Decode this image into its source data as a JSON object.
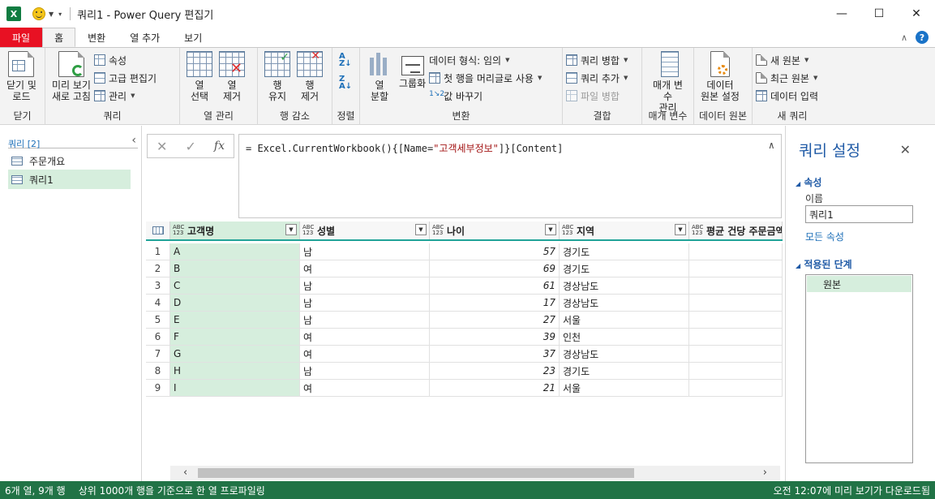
{
  "window": {
    "title": "쿼리1 - Power Query 편집기",
    "minimize": "—",
    "maximize": "☐",
    "close": "✕"
  },
  "tabs": [
    {
      "label": "파일"
    },
    {
      "label": "홈"
    },
    {
      "label": "변환"
    },
    {
      "label": "열 추가"
    },
    {
      "label": "보기"
    }
  ],
  "ribbon": {
    "close": {
      "btn": "닫기 및\n로드",
      "label": "닫기"
    },
    "query": {
      "preview": "미리 보기\n새로 고침",
      "properties": "속성",
      "advanced": "고급 편집기",
      "manage": "관리",
      "label": "쿼리"
    },
    "columns": {
      "select": "열\n선택",
      "remove": "열\n제거",
      "label": "열 관리"
    },
    "rows": {
      "keep": "행\n유지",
      "remove": "행\n제거",
      "label": "행 감소"
    },
    "sort": {
      "label": "정렬"
    },
    "transform": {
      "split": "열\n분할",
      "group": "그룹화",
      "datatype": "데이터 형식: 임의",
      "header": "첫 행을 머리글로 사용",
      "replace": "값 바꾸기",
      "label": "변환"
    },
    "combine": {
      "merge": "쿼리 병합",
      "append": "쿼리 추가",
      "files": "파일 병합",
      "label": "결합"
    },
    "params": {
      "manage": "매개 변수\n관리",
      "label": "매개 변수"
    },
    "datasource": {
      "settings": "데이터\n원본 설정",
      "label": "데이터 원본"
    },
    "newquery": {
      "source": "새 원본",
      "recent": "최근 원본",
      "enter": "데이터 입력",
      "label": "새 쿼리"
    }
  },
  "queries": {
    "header": "쿼리 [2]",
    "items": [
      {
        "label": "주문개요",
        "selected": false
      },
      {
        "label": "쿼리1",
        "selected": true
      }
    ]
  },
  "formula": {
    "prefix": "= Excel.CurrentWorkbook(){[Name=",
    "string": "\"고객세부정보\"",
    "suffix": "]}[Content]"
  },
  "grid": {
    "type_badge": "ABC\n123",
    "columns": [
      "고객명",
      "성별",
      "나이",
      "지역",
      "평균 건당 주문금액"
    ],
    "rows": [
      [
        "1",
        "A",
        "남",
        "57",
        "경기도",
        ""
      ],
      [
        "2",
        "B",
        "여",
        "69",
        "경기도",
        ""
      ],
      [
        "3",
        "C",
        "남",
        "61",
        "경상남도",
        ""
      ],
      [
        "4",
        "D",
        "남",
        "17",
        "경상남도",
        ""
      ],
      [
        "5",
        "E",
        "남",
        "27",
        "서울",
        ""
      ],
      [
        "6",
        "F",
        "여",
        "39",
        "인천",
        ""
      ],
      [
        "7",
        "G",
        "여",
        "37",
        "경상남도",
        ""
      ],
      [
        "8",
        "H",
        "남",
        "23",
        "경기도",
        ""
      ],
      [
        "9",
        "I",
        "여",
        "21",
        "서울",
        ""
      ]
    ]
  },
  "settings": {
    "title": "쿼리 설정",
    "properties": "속성",
    "name_label": "이름",
    "name_value": "쿼리1",
    "all_props": "모든 속성",
    "applied_steps": "적용된 단계",
    "steps": [
      "원본"
    ]
  },
  "status": {
    "left": "6개 열, 9개 행",
    "profile": "상위 1000개 행을 기준으로 한 열 프로파일링",
    "right": "오전 12:07에 미리 보기가 다운로드됨"
  },
  "colors": {
    "accent": "#217346",
    "selected": "#d6eedd",
    "file_tab": "#e81123",
    "teal": "#21a398"
  }
}
